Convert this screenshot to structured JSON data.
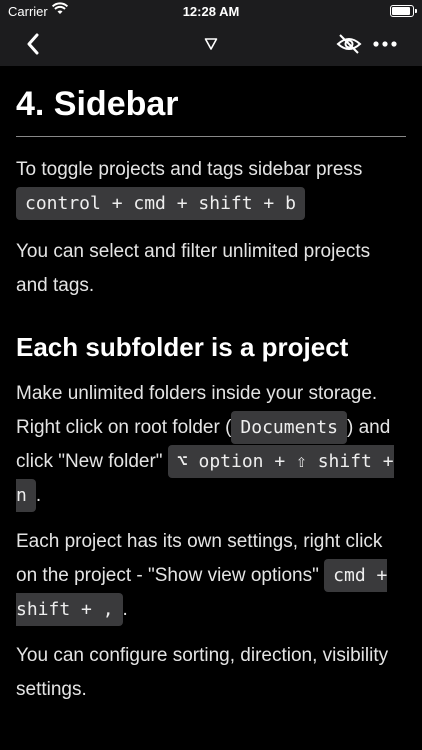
{
  "status": {
    "carrier": "Carrier",
    "time": "12:28 AM"
  },
  "nav": {
    "back_icon": "chevron-left",
    "filter_icon": "triangle-down",
    "visibility_icon": "eye-slash",
    "more_icon": "ellipsis"
  },
  "doc": {
    "title": "4. Sidebar",
    "p1_text": "To toggle projects and tags sidebar press",
    "p1_code": "control + cmd + shift + b",
    "p2": "You can select and filter unlimited projects and tags.",
    "h2": "Each subfolder is a project",
    "p3_a": "Make unlimited folders inside your storage. Right click on root folder (",
    "p3_code1": "Documents",
    "p3_b": ") and click \"New folder\" ",
    "p3_code2": "⌥ option + ⇧ shift + n",
    "p3_c": ".",
    "p4_text": "Each project has its own settings, right click on the project - \"Show view options\" ",
    "p4_code": "cmd + shift + ,",
    "p4_end": ".",
    "p5": "You can configure sorting, direction, visibility settings."
  },
  "colors": {
    "background": "#000000",
    "bar": "#1c1c1e",
    "code_bg": "#3a3a3c",
    "text": "#e4e4e4"
  }
}
